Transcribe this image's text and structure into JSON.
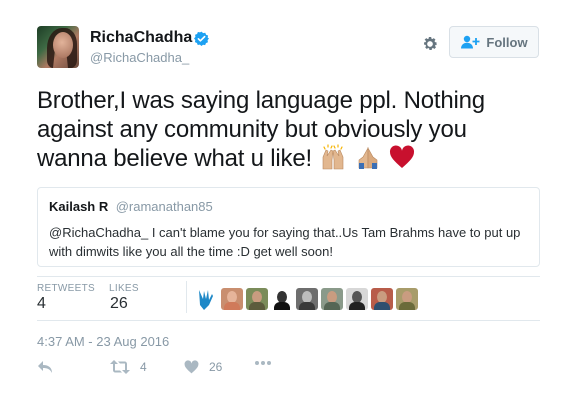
{
  "profile": {
    "display_name": "RichaChadha",
    "handle": "@RichaChadha_",
    "verified": true
  },
  "follow_button": {
    "label": "Follow"
  },
  "tweet": {
    "text": "Brother,I was saying language ppl. Nothing against any community but obviously you wanna believe what u like!",
    "emojis": [
      "raising-hands",
      "folded-hands",
      "red-heart"
    ]
  },
  "quoted_tweet": {
    "name": "Kailash R",
    "handle": "@ramanathan85",
    "text": "@RichaChadha_ I can't blame you for saying that..Us Tam Brahms have to put up with dimwits like you all the time :D get well soon!"
  },
  "stats": {
    "retweets_label": "RETWEETS",
    "retweets_count": "4",
    "likes_label": "LIKES",
    "likes_count": "26"
  },
  "timestamp": "4:37 AM - 23 Aug 2016",
  "actions": {
    "retweet_count": "4",
    "like_count": "26"
  },
  "colors": {
    "verified_blue": "#1da1f2",
    "muted_gray": "#8899a6",
    "border": "#e1e8ed",
    "heart_red": "#c8102e"
  }
}
